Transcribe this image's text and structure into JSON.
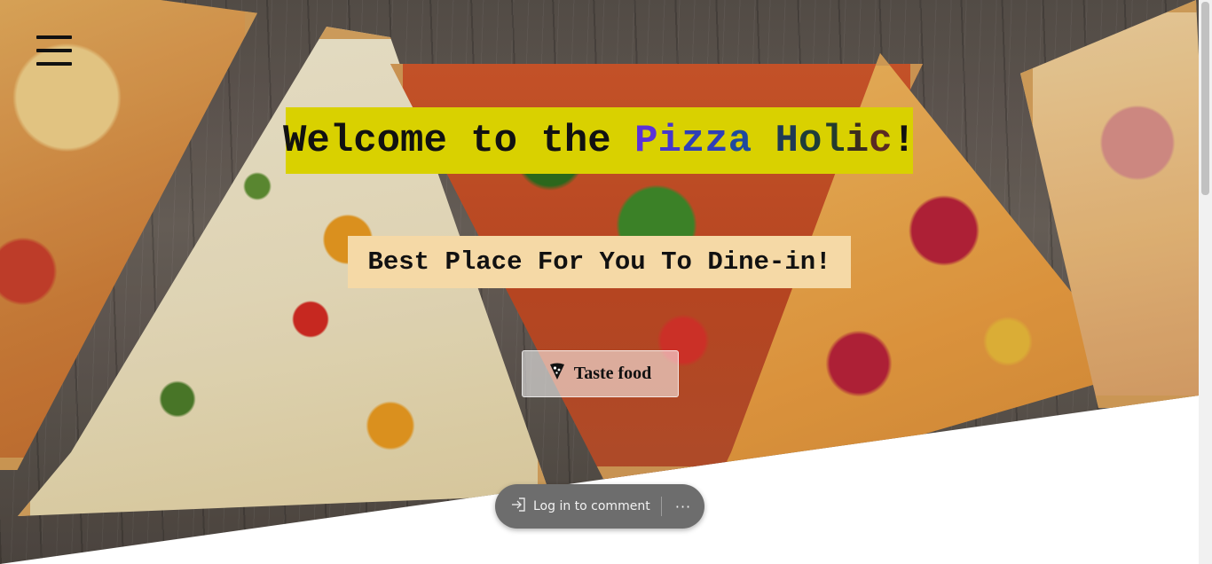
{
  "hero": {
    "title_parts": {
      "a": "Welcome to the ",
      "p": "P",
      "i": "i",
      "z1": "z",
      "z2": "z",
      "a2": "a",
      "space": " ",
      "h": "H",
      "o": "o",
      "l": "l",
      "i2": "i",
      "c": "c",
      "end": "!"
    },
    "subtitle": "Best Place For You To Dine-in!",
    "cta_label": "Taste food",
    "cta_icon": "pizza-slice-icon"
  },
  "nav": {
    "menu_icon": "hamburger-menu-icon"
  },
  "comment_bar": {
    "login_label": "Log in to comment",
    "login_icon": "login-arrow-icon",
    "more_label": "···",
    "more_icon": "more-dots-icon"
  },
  "colors": {
    "title_bg": "#d9d100",
    "subtitle_bg": "#f5d9a6",
    "pill_bg": "#6d6d6d"
  }
}
